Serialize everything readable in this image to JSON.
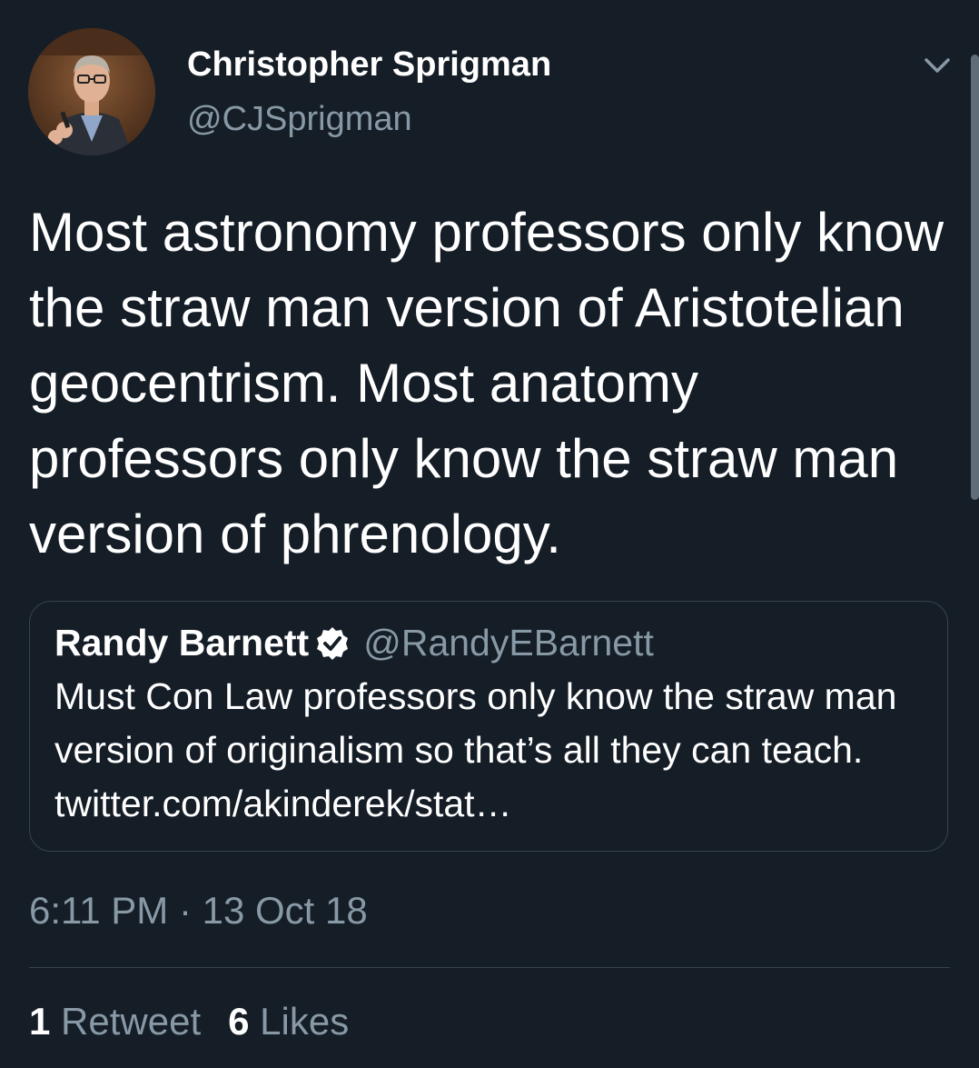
{
  "tweet": {
    "author": {
      "display_name": "Christopher Sprigman",
      "handle": "@CJSprigman"
    },
    "text": "Most astronomy professors only know the straw man version of Aristotelian geocentrism. Most anatomy professors only know the straw man version of phrenology.",
    "quoted": {
      "display_name": "Randy Barnett",
      "handle": "@RandyEBarnett",
      "verified": true,
      "text": "Must Con Law professors only know the straw man version of originalism so that’s all they can teach. twitter.com/akinderek/stat…"
    },
    "timestamp": "6:11 PM · 13 Oct 18",
    "stats": {
      "retweets_count": "1",
      "retweets_label": "Retweet",
      "likes_count": "6",
      "likes_label": "Likes"
    }
  },
  "icons": {
    "menu": "chevron-down-icon",
    "verified": "verified-badge-icon"
  },
  "colors": {
    "background": "#151d27",
    "primary_text": "#ffffff",
    "secondary_text": "#8899a6",
    "border": "#38444d"
  }
}
